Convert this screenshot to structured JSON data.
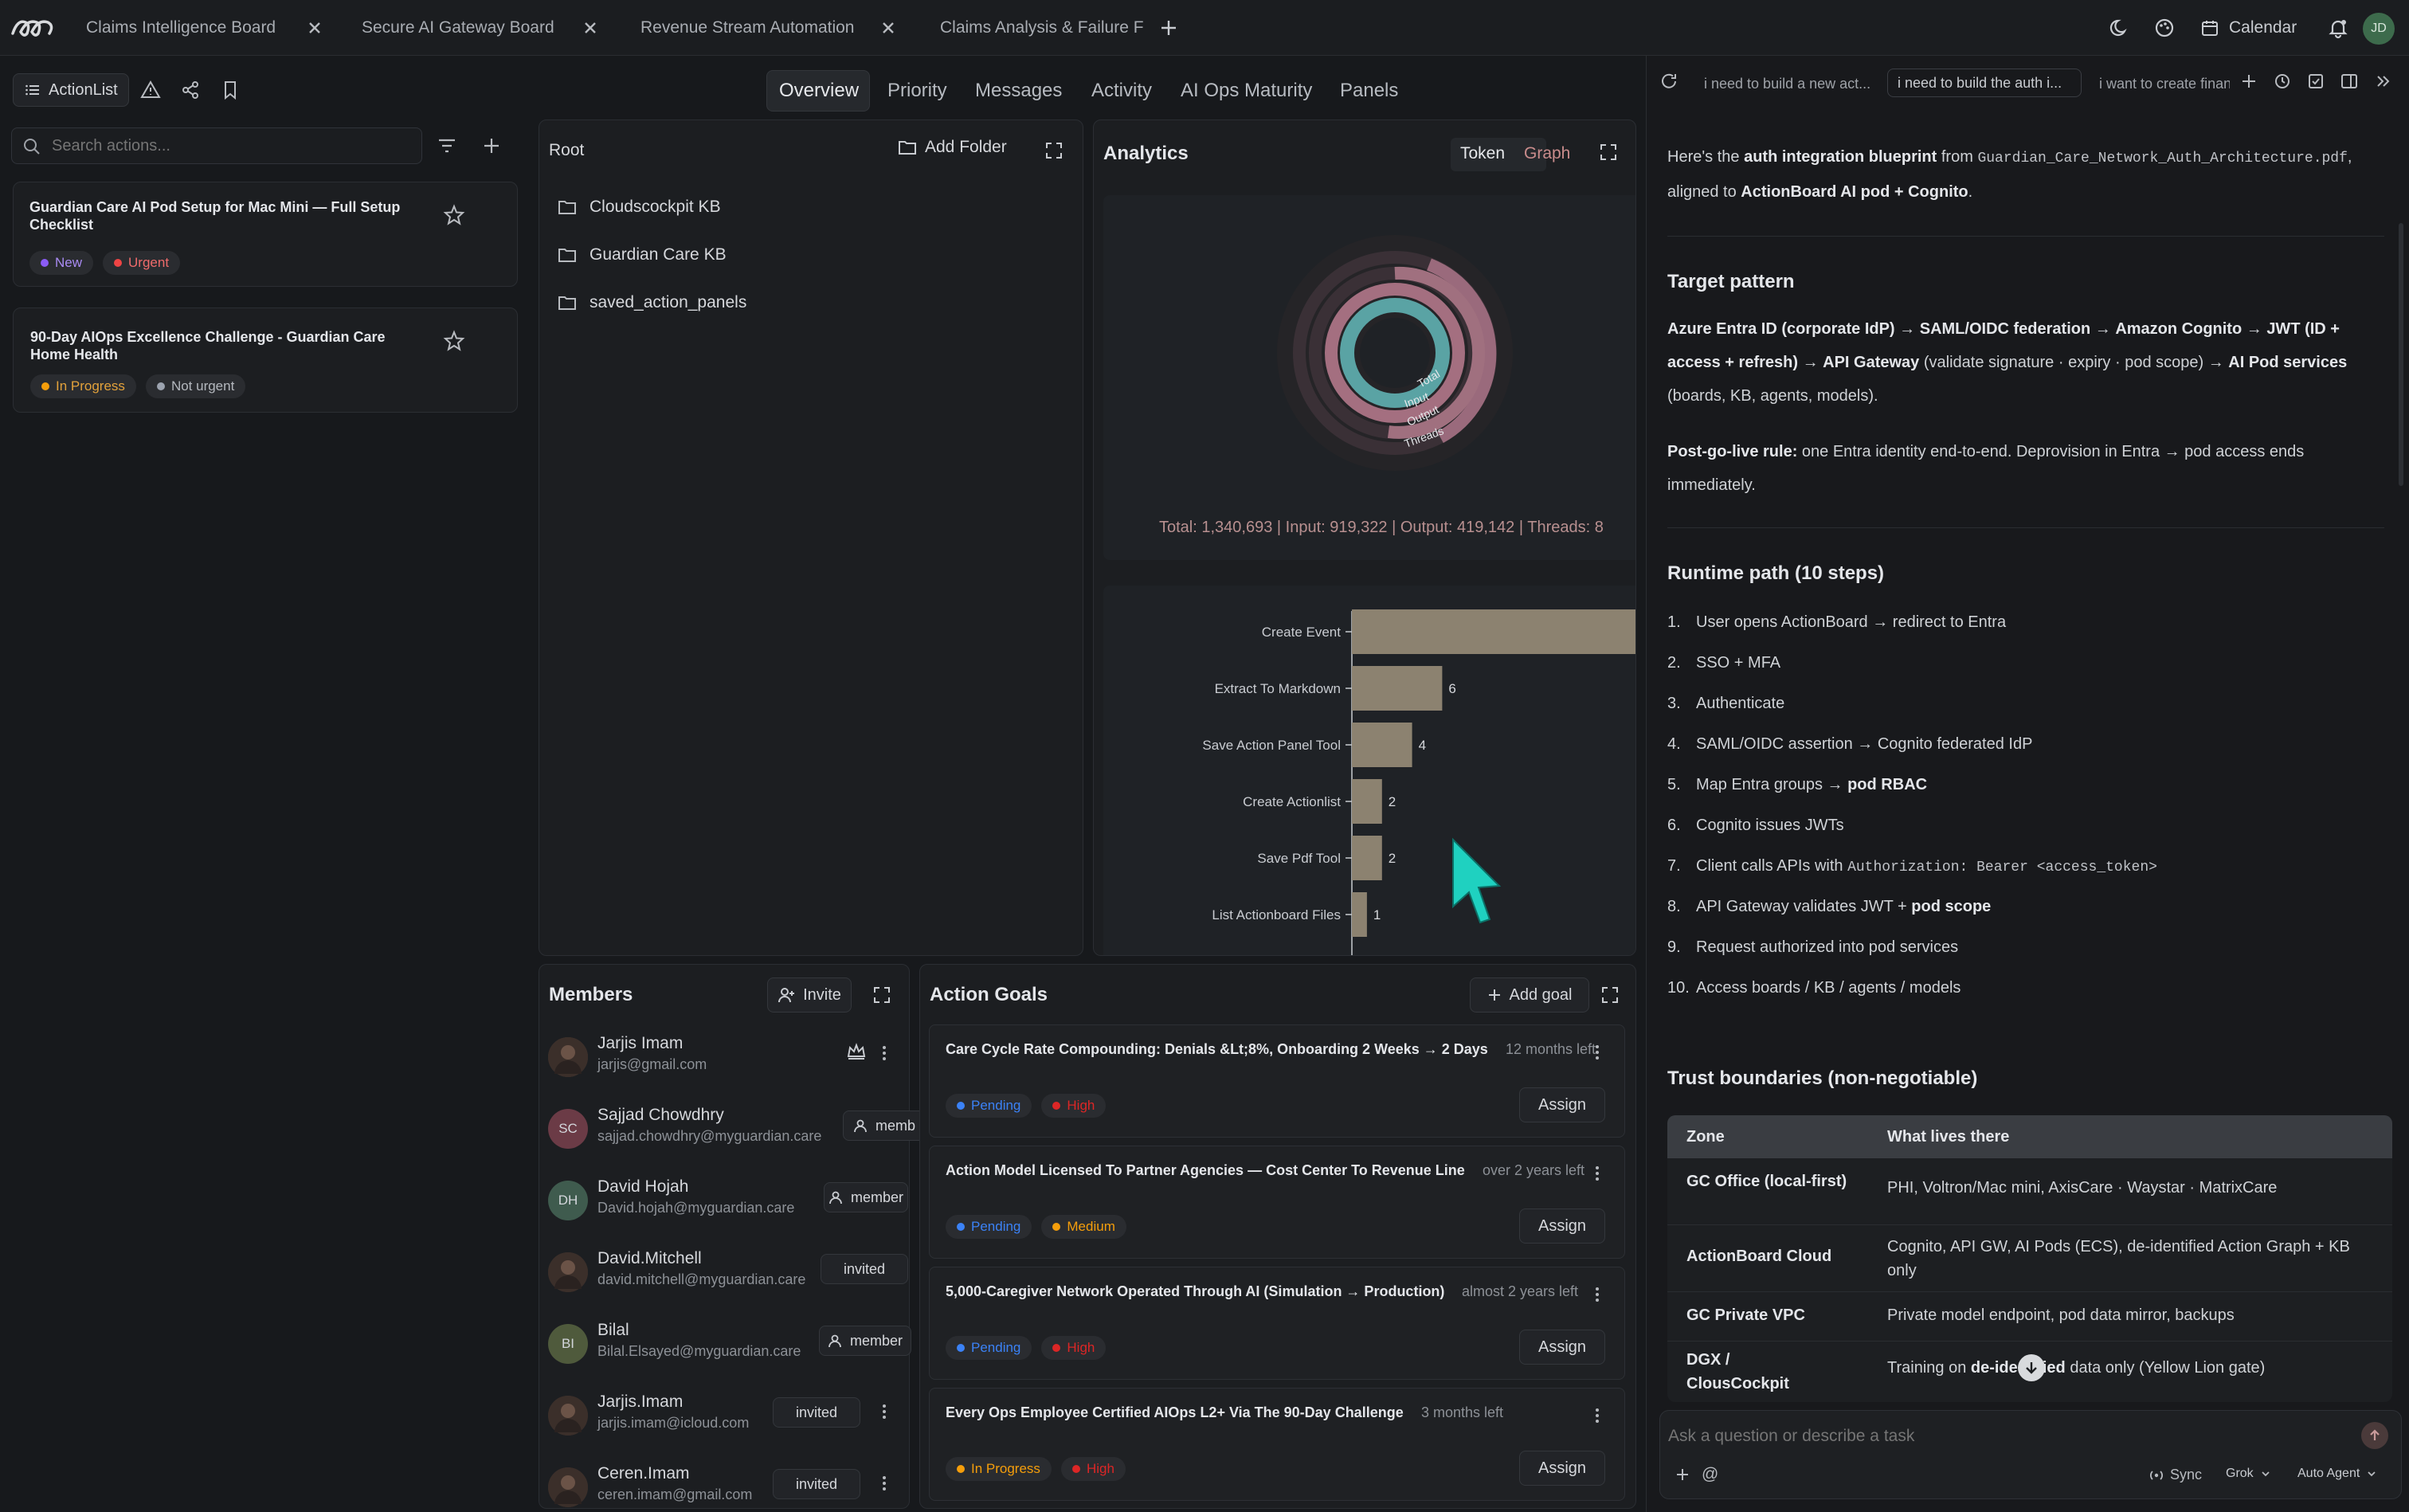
{
  "tabs": [
    {
      "label": "Claims Intelligence Board"
    },
    {
      "label": "Secure AI Gateway Board"
    },
    {
      "label": "Revenue Stream Automation"
    },
    {
      "label": "Claims Analysis & Failure F"
    }
  ],
  "topbar": {
    "calendar_label": "Calendar",
    "avatar_initials": "JD"
  },
  "left": {
    "title": "ActionList",
    "search_placeholder": "Search actions...",
    "actions": [
      {
        "title": "Guardian Care AI Pod Setup for Mac Mini — Full Setup Checklist",
        "badges": [
          {
            "label": "New",
            "color": "#8b5cf6"
          },
          {
            "label": "Urgent",
            "color": "#ef4444"
          }
        ]
      },
      {
        "title": "90-Day AIOps Excellence Challenge - Guardian Care Home Health",
        "badges": [
          {
            "label": "In Progress",
            "color": "#f59e0b"
          },
          {
            "label": "Not urgent",
            "color": "#9ca3af"
          }
        ]
      }
    ]
  },
  "nav": {
    "tabs": [
      "Overview",
      "Priority",
      "Messages",
      "Activity",
      "AI Ops Maturity",
      "Panels"
    ],
    "active": "Overview"
  },
  "files": {
    "root_label": "Root",
    "add_folder_label": "Add Folder",
    "folders": [
      "Cloudscockpit KB",
      "Guardian Care KB",
      "saved_action_panels"
    ]
  },
  "analytics": {
    "title": "Analytics",
    "toggle": [
      "Token",
      "Graph"
    ],
    "ring_labels": [
      "Total",
      "Input",
      "Output",
      "Threads"
    ],
    "summary": "Total: 1,340,693 | Input: 919,322 | Output: 419,142 | Threads: 8"
  },
  "chart_data": {
    "type": "bar",
    "categories": [
      "Create Event",
      "Extract To Markdown",
      "Save Action Panel Tool",
      "Create Actionlist",
      "Save Pdf Tool",
      "List Actionboard Files"
    ],
    "values": [
      20,
      6,
      4,
      2,
      2,
      1
    ],
    "value_labels": [
      "",
      "6",
      "4",
      "2",
      "2",
      "1"
    ],
    "orientation": "horizontal",
    "bar_color": "#8c8270"
  },
  "members": {
    "title": "Members",
    "invite_label": "Invite",
    "list": [
      {
        "name": "Jarjis Imam",
        "email": "jarjis@gmail.com",
        "initials": "",
        "role": "",
        "owner": true
      },
      {
        "name": "Sajjad Chowdhry",
        "email": "sajjad.chowdhry@myguardian.care",
        "initials": "SC",
        "role": "memb",
        "owner": false
      },
      {
        "name": "David Hojah",
        "email": "David.hojah@myguardian.care",
        "initials": "DH",
        "role": "member",
        "owner": false
      },
      {
        "name": "David.Mitchell",
        "email": "david.mitchell@myguardian.care",
        "initials": "",
        "role": "invited",
        "owner": false
      },
      {
        "name": "Bilal",
        "email": "Bilal.Elsayed@myguardian.care",
        "initials": "BI",
        "role": "member",
        "owner": false
      },
      {
        "name": "Jarjis.Imam",
        "email": "jarjis.imam@icloud.com",
        "initials": "",
        "role": "invited",
        "owner": false
      },
      {
        "name": "Ceren.Imam",
        "email": "ceren.imam@gmail.com",
        "initials": "",
        "role": "invited",
        "owner": false
      }
    ]
  },
  "goals": {
    "title": "Action Goals",
    "add_label": "Add goal",
    "assign_label": "Assign",
    "list": [
      {
        "title": "Care Cycle Rate Compounding: Denials &Lt;8%, Onboarding 2 Weeks → 2 Days",
        "due": "12 months left",
        "status": "Pending",
        "status_color": "#3b82f6",
        "priority": "High",
        "priority_color": "#dc2626"
      },
      {
        "title": "Action Model Licensed To Partner Agencies — Cost Center To Revenue Line",
        "due": "over 2 years left",
        "status": "Pending",
        "status_color": "#3b82f6",
        "priority": "Medium",
        "priority_color": "#f59e0b"
      },
      {
        "title": "5,000-Caregiver Network Operated Through AI (Simulation → Production)",
        "due": "almost 2 years left",
        "status": "Pending",
        "status_color": "#3b82f6",
        "priority": "High",
        "priority_color": "#dc2626"
      },
      {
        "title": "Every Ops Employee Certified AIOps L2+ Via The 90-Day Challenge",
        "due": "3 months left",
        "status": "In Progress",
        "status_color": "#f59e0b",
        "priority": "High",
        "priority_color": "#dc2626"
      }
    ]
  },
  "chat": {
    "tabs": [
      "i need to build a new act...",
      "i need to build the auth i...",
      "i want to create financi..."
    ],
    "intro_pre": "Here's the ",
    "intro_bold": "auth integration blueprint",
    "intro_from": " from ",
    "intro_file": "Guardian_Care_Network_Auth_Architecture.pdf",
    "intro_post": ",",
    "intro_line2_pre": "aligned to ",
    "intro_line2_bold": "ActionBoard AI pod + Cognito",
    "intro_line2_post": ".",
    "target_heading": "Target pattern",
    "target_b1": "Azure Entra ID (corporate IdP)",
    "target_a1": " → ",
    "target_b2": "SAML/OIDC federation",
    "target_a2": " → ",
    "target_b3": "Amazon Cognito",
    "target_a3": " → ",
    "target_b4": "JWT (ID + access + refresh)",
    "target_a4": " → ",
    "target_b5": "API Gateway",
    "target_t5": " (validate signature · expiry · pod scope) → ",
    "target_b6": "AI Pod services",
    "target_t6": " (boards, KB, agents, models).",
    "rule_bold": "Post-go-live rule:",
    "rule_text": " one Entra identity end-to-end. Deprovision in Entra → pod access ends immediately.",
    "runtime_heading": "Runtime path (10 steps)",
    "steps": [
      {
        "num": "1.",
        "text": "User opens ActionBoard → redirect to Entra"
      },
      {
        "num": "2.",
        "text": "SSO + MFA"
      },
      {
        "num": "3.",
        "text": "Authenticate"
      },
      {
        "num": "4.",
        "text": "SAML/OIDC assertion → Cognito federated IdP"
      },
      {
        "num": "5.",
        "text": "Map Entra groups → ",
        "bold": "pod RBAC"
      },
      {
        "num": "6.",
        "text": "Cognito issues JWTs"
      },
      {
        "num": "7.",
        "text": "Client calls APIs with ",
        "code": "Authorization: Bearer <access_token>"
      },
      {
        "num": "8.",
        "text": "API Gateway validates JWT + ",
        "bold": "pod scope"
      },
      {
        "num": "9.",
        "text": "Request authorized into pod services"
      },
      {
        "num": "10.",
        "text": "Access boards / KB / agents / models"
      }
    ],
    "trust_heading": "Trust boundaries (non-negotiable)",
    "table_headers": [
      "Zone",
      "What lives there"
    ],
    "table_rows": [
      {
        "zone": "GC Office (local-first)",
        "what": "PHI, Voltron/Mac mini, AxisCare · Waystar · MatrixCare"
      },
      {
        "zone": "ActionBoard Cloud",
        "what": "Cognito, API GW, AI Pods (ECS), de-identified Action Graph + KB only"
      },
      {
        "zone": "GC Private VPC",
        "what": "Private model endpoint, pod data mirror, backups"
      },
      {
        "zone": "DGX / ClousCockpit",
        "what_pre": "Training on ",
        "what_bold": "de-identified",
        "what_post": " data only (Yellow Lion gate)"
      }
    ],
    "input_placeholder": "Ask a question or describe a task",
    "sync_label": "Sync",
    "model_label": "Grok",
    "agent_label": "Auto Agent"
  }
}
